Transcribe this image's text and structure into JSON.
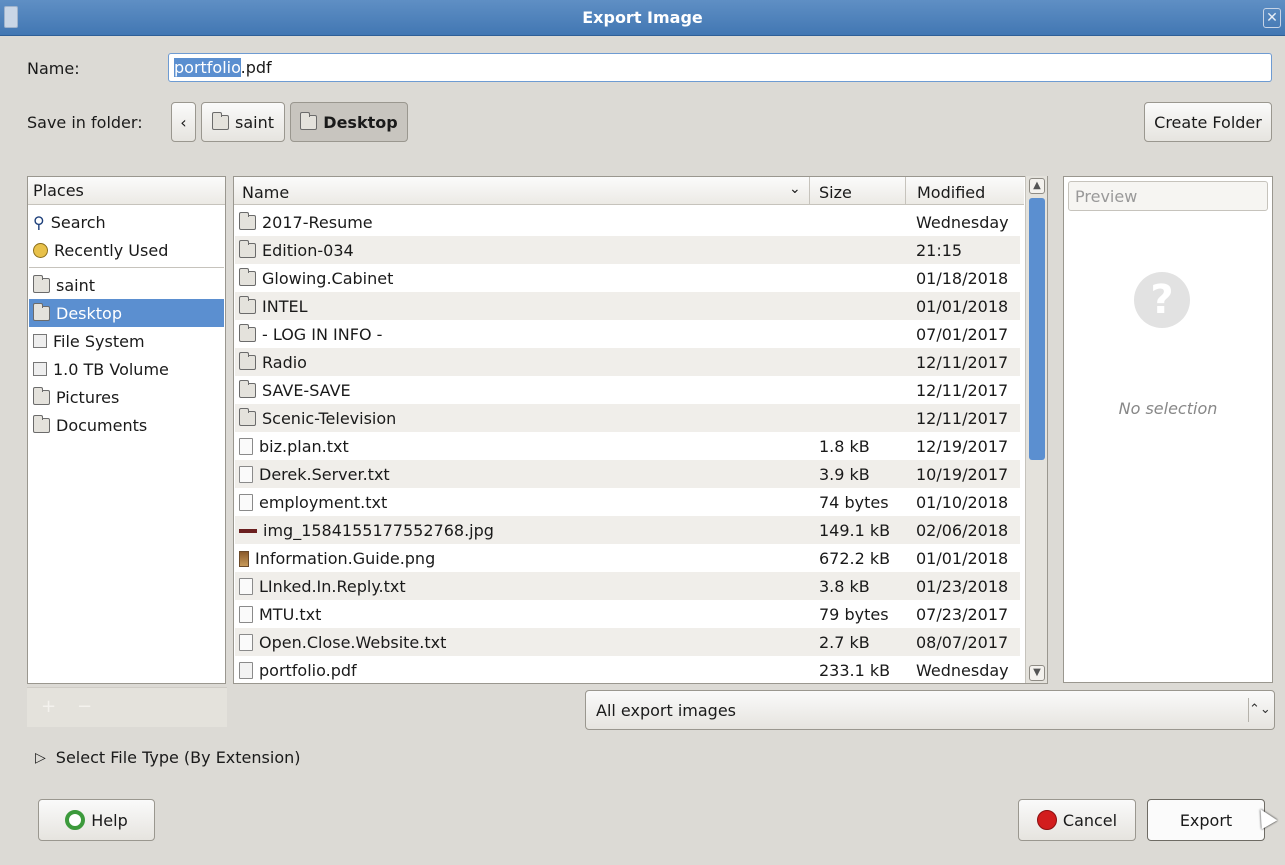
{
  "window": {
    "title": "Export Image"
  },
  "name_field": {
    "label": "Name:",
    "selected_part": "portfolio",
    "rest": ".pdf"
  },
  "folder": {
    "label": "Save in folder:",
    "back_symbol": "‹",
    "crumbs": [
      {
        "label": "saint"
      },
      {
        "label": "Desktop"
      }
    ],
    "create_folder_label": "Create Folder"
  },
  "places": {
    "header": "Places",
    "items": [
      {
        "label": "Search",
        "icon": "search-icon"
      },
      {
        "label": "Recently Used",
        "icon": "recent-icon"
      },
      {
        "label": "saint",
        "icon": "home-folder-icon"
      },
      {
        "label": "Desktop",
        "icon": "desktop-folder-icon",
        "selected": true
      },
      {
        "label": "File System",
        "icon": "drive-icon"
      },
      {
        "label": "1.0 TB Volume",
        "icon": "drive-icon"
      },
      {
        "label": "Pictures",
        "icon": "pictures-folder-icon"
      },
      {
        "label": "Documents",
        "icon": "documents-folder-icon"
      }
    ]
  },
  "files": {
    "columns": {
      "name": "Name",
      "size": "Size",
      "modified": "Modified"
    },
    "rows": [
      {
        "name": "2017-Resume",
        "size": "",
        "modified": "Wednesday",
        "kind": "folder"
      },
      {
        "name": "Edition-034",
        "size": "",
        "modified": "21:15",
        "kind": "folder"
      },
      {
        "name": "Glowing.Cabinet",
        "size": "",
        "modified": "01/18/2018",
        "kind": "folder"
      },
      {
        "name": "INTEL",
        "size": "",
        "modified": "01/01/2018",
        "kind": "folder"
      },
      {
        "name": "- LOG IN INFO -",
        "size": "",
        "modified": "07/01/2017",
        "kind": "folder"
      },
      {
        "name": "Radio",
        "size": "",
        "modified": "12/11/2017",
        "kind": "folder"
      },
      {
        "name": "SAVE-SAVE",
        "size": "",
        "modified": "12/11/2017",
        "kind": "folder"
      },
      {
        "name": "Scenic-Television",
        "size": "",
        "modified": "12/11/2017",
        "kind": "folder"
      },
      {
        "name": "biz.plan.txt",
        "size": "1.8 kB",
        "modified": "12/19/2017",
        "kind": "text"
      },
      {
        "name": "Derek.Server.txt",
        "size": "3.9 kB",
        "modified": "10/19/2017",
        "kind": "text"
      },
      {
        "name": "employment.txt",
        "size": "74 bytes",
        "modified": "01/10/2018",
        "kind": "text"
      },
      {
        "name": "img_1584155177552768.jpg",
        "size": "149.1 kB",
        "modified": "02/06/2018",
        "kind": "image"
      },
      {
        "name": "Information.Guide.png",
        "size": "672.2 kB",
        "modified": "01/01/2018",
        "kind": "image"
      },
      {
        "name": "LInked.In.Reply.txt",
        "size": "3.8 kB",
        "modified": "01/23/2018",
        "kind": "text"
      },
      {
        "name": "MTU.txt",
        "size": "79 bytes",
        "modified": "07/23/2017",
        "kind": "text"
      },
      {
        "name": "Open.Close.Website.txt",
        "size": "2.7 kB",
        "modified": "08/07/2017",
        "kind": "text"
      },
      {
        "name": "portfolio.pdf",
        "size": "233.1 kB",
        "modified": "Wednesday",
        "kind": "pdf"
      }
    ]
  },
  "preview": {
    "header": "Preview",
    "empty_text": "No selection"
  },
  "filter": {
    "selected": "All export images",
    "arrow_symbol": "⌃⌄"
  },
  "file_type_expander": {
    "label": "Select File Type (By Extension)",
    "symbol": "▷"
  },
  "buttons": {
    "help": "Help",
    "cancel": "Cancel",
    "export": "Export"
  },
  "colors": {
    "accent": "#5b8fd0",
    "titlebar": "#4a7fbc",
    "background": "#dcdad5"
  }
}
